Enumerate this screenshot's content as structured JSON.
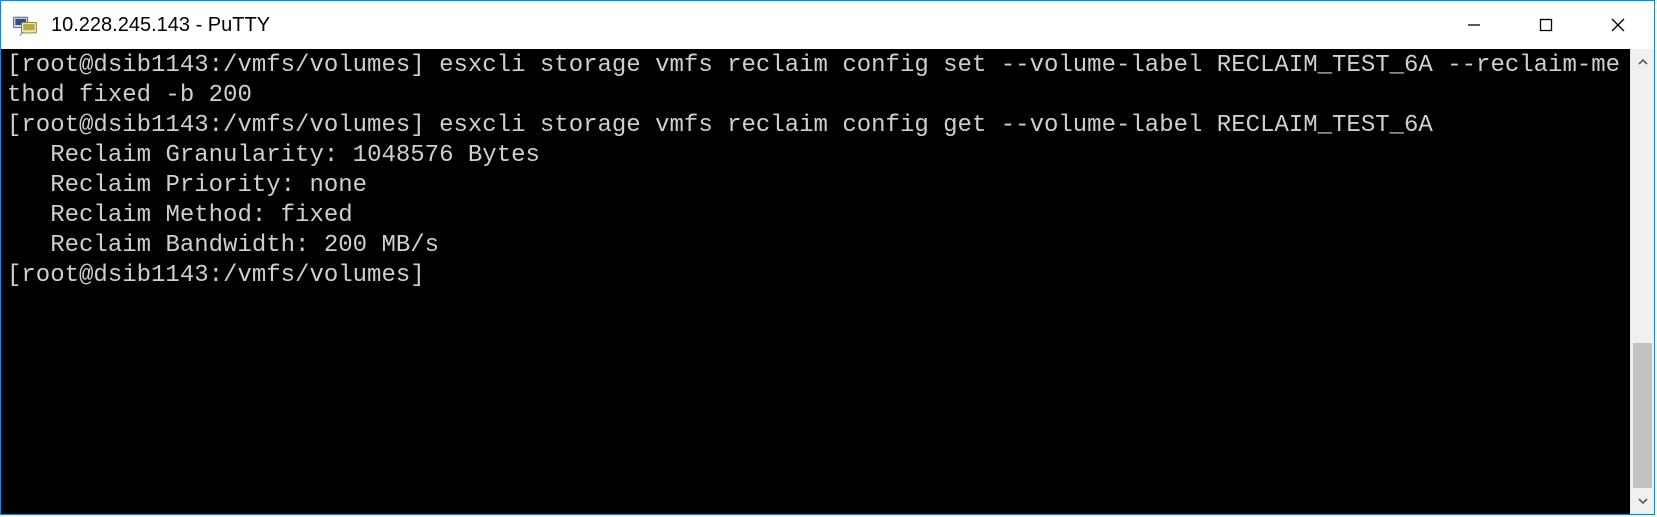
{
  "window": {
    "title": "10.228.245.143 - PuTTY"
  },
  "terminal": {
    "lines": [
      "[root@dsib1143:/vmfs/volumes] esxcli storage vmfs reclaim config set --volume-label RECLAIM_TEST_6A --reclaim-method fixed -b 200",
      "[root@dsib1143:/vmfs/volumes] esxcli storage vmfs reclaim config get --volume-label RECLAIM_TEST_6A",
      "   Reclaim Granularity: 1048576 Bytes",
      "   Reclaim Priority: none",
      "   Reclaim Method: fixed",
      "   Reclaim Bandwidth: 200 MB/s",
      "[root@dsib1143:/vmfs/volumes]"
    ]
  }
}
